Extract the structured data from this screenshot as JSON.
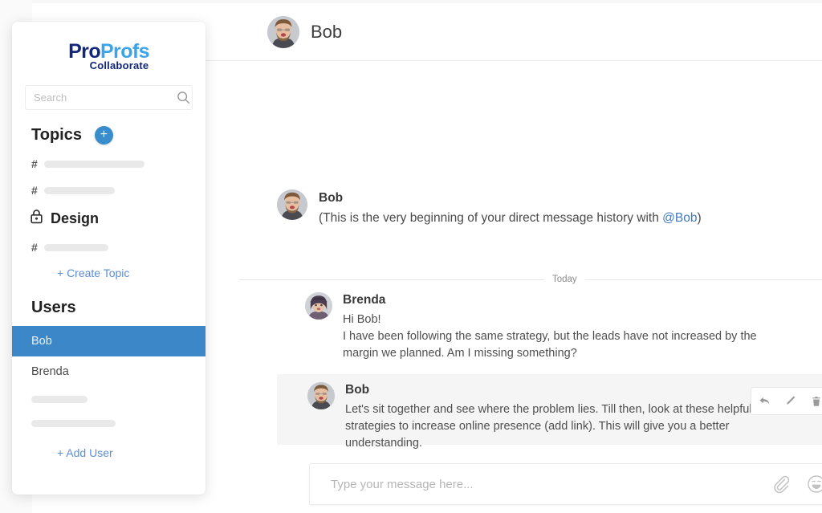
{
  "sidebar": {
    "logo": {
      "part1": "Pro",
      "part2": "Profs",
      "subtitle": "Collaborate"
    },
    "search": {
      "placeholder": "Search",
      "value": "",
      "icon": "search-icon"
    },
    "topics": {
      "title": "Topics",
      "add_button_label": "+",
      "items": [
        {
          "prefix": "#",
          "label": "",
          "skeleton_width": 125
        },
        {
          "prefix": "#",
          "label": "",
          "skeleton_width": 88
        }
      ],
      "locked_topic": {
        "icon": "lock-icon",
        "label": "Design"
      },
      "items_after": [
        {
          "prefix": "#",
          "label": "",
          "skeleton_width": 80
        }
      ],
      "create_link": "+ Create Topic"
    },
    "users": {
      "title": "Users",
      "items": [
        {
          "label": "Bob",
          "selected": true
        },
        {
          "label": "Brenda",
          "selected": false
        }
      ],
      "skeletons": [
        70,
        105
      ],
      "add_link": "+ Add User"
    }
  },
  "header": {
    "avatar": "bob-avatar",
    "title": "Bob"
  },
  "conversation": {
    "intro": {
      "author": "Bob",
      "avatar": "bob-avatar",
      "text_before": "(This is the very beginning of your direct message history with ",
      "mention": "@Bob",
      "text_after": ")"
    },
    "day_divider": "Today",
    "messages": [
      {
        "author": "Brenda",
        "avatar": "brenda-avatar",
        "lines": [
          "Hi Bob!",
          "I have been following the same strategy, but the leads have not increased by the margin we planned. Am I missing something?"
        ],
        "highlighted": false
      },
      {
        "author": "Bob",
        "avatar": "bob-avatar",
        "lines": [
          "Let's sit together and see where the problem lies. Till then, look at these helpful strategies to increase online presence (add link). This will give you a better understanding."
        ],
        "highlighted": true,
        "actions": [
          {
            "name": "reply-icon",
            "label": "Reply"
          },
          {
            "name": "edit-icon",
            "label": "Edit"
          },
          {
            "name": "delete-icon",
            "label": "Delete"
          }
        ]
      }
    ]
  },
  "composer": {
    "placeholder": "Type your message here...",
    "value": "",
    "tools": [
      {
        "name": "attachment-icon",
        "label": "Attach file"
      },
      {
        "name": "emoji-icon",
        "label": "Insert emoji"
      }
    ]
  },
  "colors": {
    "accent_blue": "#3a8dcc",
    "selected_blue": "#3b87c8",
    "link_blue": "#5b8ed6",
    "mention_blue": "#3f79c0",
    "logo_dark": "#13277a",
    "logo_light": "#3ba3e8",
    "highlight_gray": "#f5f5f5"
  }
}
